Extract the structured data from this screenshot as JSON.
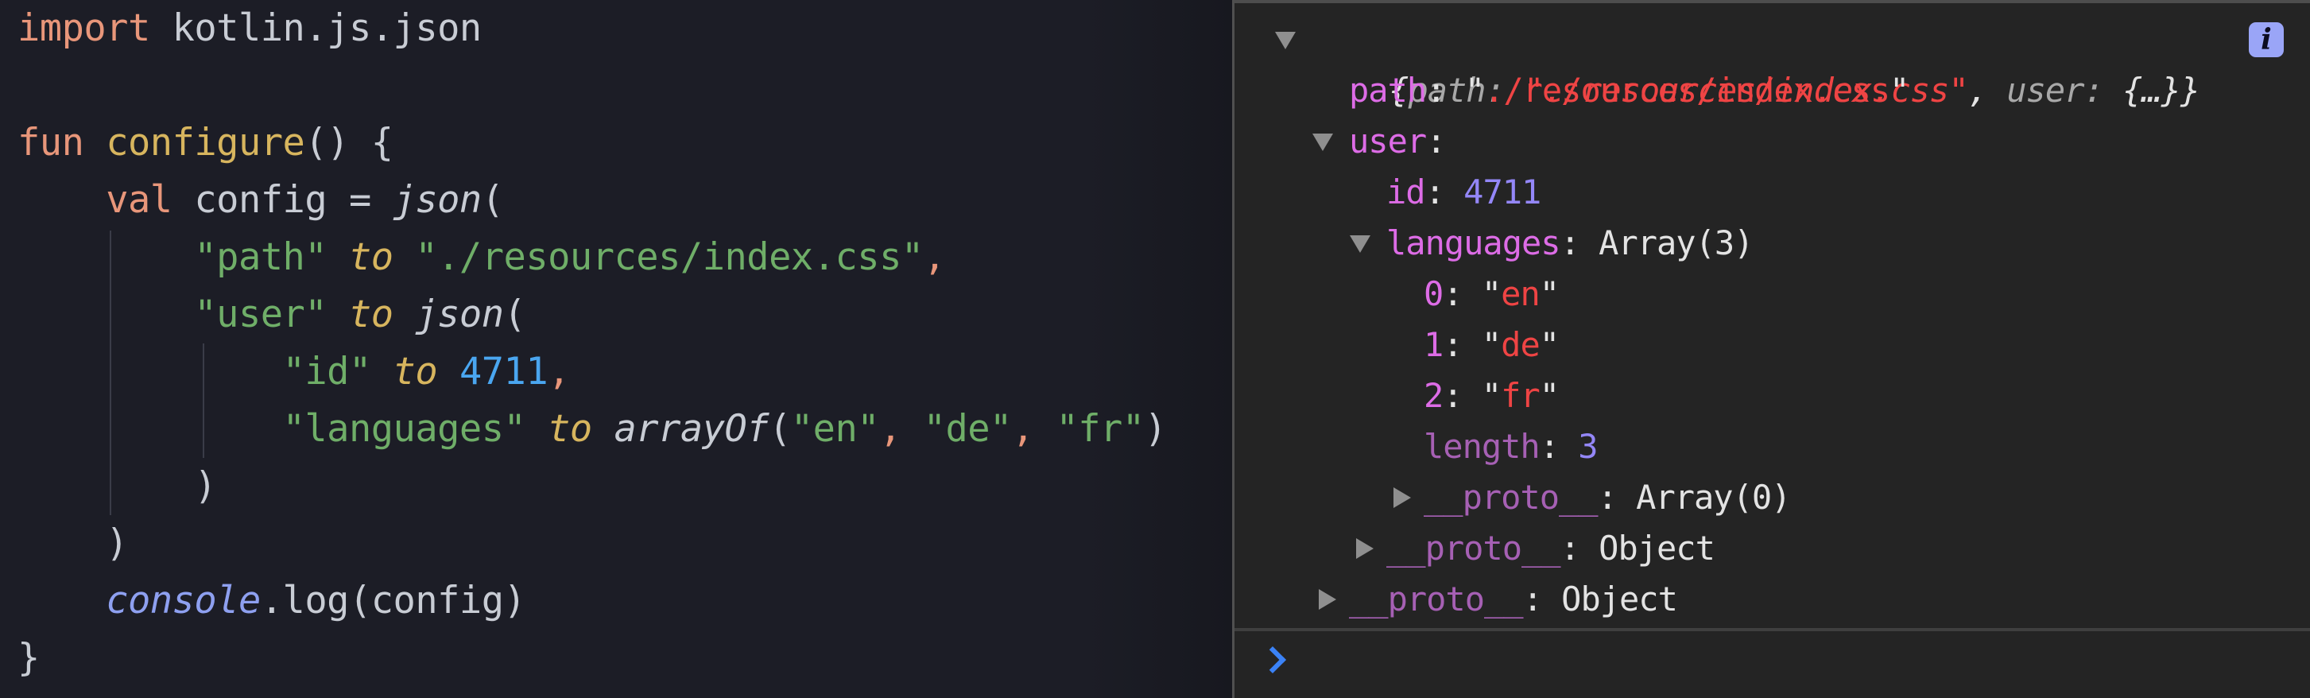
{
  "editor": {
    "language": "kotlin",
    "lines": [
      {
        "tokens": [
          {
            "t": "import",
            "c": "kw"
          },
          {
            "t": " kotlin.js.json",
            "c": "plain"
          }
        ]
      },
      {
        "tokens": []
      },
      {
        "tokens": [
          {
            "t": "fun",
            "c": "kw"
          },
          {
            "t": " ",
            "c": "plain"
          },
          {
            "t": "configure",
            "c": "fn"
          },
          {
            "t": "() {",
            "c": "plain"
          }
        ]
      },
      {
        "tokens": [
          {
            "t": "    ",
            "c": "plain"
          },
          {
            "t": "val",
            "c": "kw"
          },
          {
            "t": " config = ",
            "c": "plain"
          },
          {
            "t": "json",
            "c": "plain ital"
          },
          {
            "t": "(",
            "c": "plain"
          }
        ]
      },
      {
        "tokens": [
          {
            "t": "        ",
            "c": "plain"
          },
          {
            "t": "\"path\"",
            "c": "str"
          },
          {
            "t": " ",
            "c": "plain"
          },
          {
            "t": "to",
            "c": "infix"
          },
          {
            "t": " ",
            "c": "plain"
          },
          {
            "t": "\"./resources/index.css\"",
            "c": "str"
          },
          {
            "t": ",",
            "c": "comma"
          }
        ]
      },
      {
        "tokens": [
          {
            "t": "        ",
            "c": "plain"
          },
          {
            "t": "\"user\"",
            "c": "str"
          },
          {
            "t": " ",
            "c": "plain"
          },
          {
            "t": "to",
            "c": "infix"
          },
          {
            "t": " ",
            "c": "plain"
          },
          {
            "t": "json",
            "c": "plain ital"
          },
          {
            "t": "(",
            "c": "plain"
          }
        ]
      },
      {
        "tokens": [
          {
            "t": "            ",
            "c": "plain"
          },
          {
            "t": "\"id\"",
            "c": "str"
          },
          {
            "t": " ",
            "c": "plain"
          },
          {
            "t": "to",
            "c": "infix"
          },
          {
            "t": " ",
            "c": "plain"
          },
          {
            "t": "4711",
            "c": "num"
          },
          {
            "t": ",",
            "c": "comma"
          }
        ]
      },
      {
        "tokens": [
          {
            "t": "            ",
            "c": "plain"
          },
          {
            "t": "\"languages\"",
            "c": "str"
          },
          {
            "t": " ",
            "c": "plain"
          },
          {
            "t": "to",
            "c": "infix"
          },
          {
            "t": " ",
            "c": "plain"
          },
          {
            "t": "arrayOf",
            "c": "plain ital"
          },
          {
            "t": "(",
            "c": "plain"
          },
          {
            "t": "\"en\"",
            "c": "str"
          },
          {
            "t": ", ",
            "c": "comma"
          },
          {
            "t": "\"de\"",
            "c": "str"
          },
          {
            "t": ", ",
            "c": "comma"
          },
          {
            "t": "\"fr\"",
            "c": "str"
          },
          {
            "t": ")",
            "c": "plain"
          }
        ]
      },
      {
        "tokens": [
          {
            "t": "        )",
            "c": "plain"
          }
        ]
      },
      {
        "tokens": [
          {
            "t": "    )",
            "c": "plain"
          }
        ]
      },
      {
        "tokens": [
          {
            "t": "    ",
            "c": "plain"
          },
          {
            "t": "console",
            "c": "glob"
          },
          {
            "t": ".log(config)",
            "c": "plain"
          }
        ]
      },
      {
        "tokens": [
          {
            "t": "}",
            "c": "plain"
          }
        ]
      }
    ]
  },
  "console": {
    "summary": {
      "open_brace": "{",
      "path_key": "path: ",
      "path_value": "\"./resources/index.css\"",
      "sep": ", ",
      "user_key": "user: ",
      "user_value": "{…}",
      "close_brace": "}",
      "info_badge": "i"
    },
    "rows": [
      {
        "depth": 1,
        "toggle": null,
        "key": "path",
        "key_style": "key",
        "value": "./resources/index.css",
        "value_type": "string"
      },
      {
        "depth": 1,
        "toggle": "down",
        "key": "user",
        "key_style": "key",
        "value": "",
        "value_type": "none"
      },
      {
        "depth": 2,
        "toggle": null,
        "key": "id",
        "key_style": "key",
        "value": "4711",
        "value_type": "number"
      },
      {
        "depth": 2,
        "toggle": "down",
        "key": "languages",
        "key_style": "key",
        "value": "Array(3)",
        "value_type": "plain"
      },
      {
        "depth": 3,
        "toggle": null,
        "key": "0",
        "key_style": "key",
        "value": "en",
        "value_type": "string"
      },
      {
        "depth": 3,
        "toggle": null,
        "key": "1",
        "key_style": "key",
        "value": "de",
        "value_type": "string"
      },
      {
        "depth": 3,
        "toggle": null,
        "key": "2",
        "key_style": "key",
        "value": "fr",
        "value_type": "string"
      },
      {
        "depth": 3,
        "toggle": null,
        "key": "length",
        "key_style": "key-dim",
        "value": "3",
        "value_type": "number"
      },
      {
        "depth": 3,
        "toggle": "right",
        "key": "__proto__",
        "key_style": "key-dim",
        "value": "Array(0)",
        "value_type": "plain"
      },
      {
        "depth": 2,
        "toggle": "right",
        "key": "__proto__",
        "key_style": "key-dim",
        "value": "Object",
        "value_type": "plain"
      },
      {
        "depth": 1,
        "toggle": "right",
        "key": "__proto__",
        "key_style": "key-dim",
        "value": "Object",
        "value_type": "plain"
      }
    ],
    "prompt": {
      "value": "",
      "placeholder": ""
    }
  },
  "colors": {
    "editor_bg": "#1c1d26",
    "console_bg": "#242424",
    "prompt_accent": "#3b82f6",
    "info_badge": "#9aa5f7"
  }
}
